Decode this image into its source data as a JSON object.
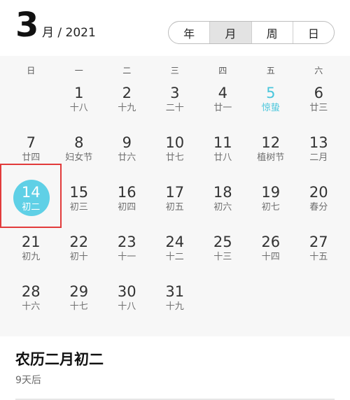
{
  "header": {
    "month_number": "3",
    "month_suffix": "月 / 2021",
    "view_tabs": [
      {
        "label": "年",
        "active": false
      },
      {
        "label": "月",
        "active": true
      },
      {
        "label": "周",
        "active": false
      },
      {
        "label": "日",
        "active": false
      }
    ]
  },
  "weekdays": [
    "日",
    "一",
    "二",
    "三",
    "四",
    "五",
    "六"
  ],
  "calendar": {
    "weeks": [
      [
        {
          "day": "",
          "lunar": ""
        },
        {
          "day": "1",
          "lunar": "十八"
        },
        {
          "day": "2",
          "lunar": "十九"
        },
        {
          "day": "3",
          "lunar": "二十"
        },
        {
          "day": "4",
          "lunar": "廿一"
        },
        {
          "day": "5",
          "lunar": "惊蛰",
          "holiday": true
        },
        {
          "day": "6",
          "lunar": "廿三"
        }
      ],
      [
        {
          "day": "7",
          "lunar": "廿四"
        },
        {
          "day": "8",
          "lunar": "妇女节"
        },
        {
          "day": "9",
          "lunar": "廿六"
        },
        {
          "day": "10",
          "lunar": "廿七"
        },
        {
          "day": "11",
          "lunar": "廿八"
        },
        {
          "day": "12",
          "lunar": "植树节"
        },
        {
          "day": "13",
          "lunar": "二月"
        }
      ],
      [
        {
          "day": "14",
          "lunar": "初二",
          "selected": true
        },
        {
          "day": "15",
          "lunar": "初三"
        },
        {
          "day": "16",
          "lunar": "初四"
        },
        {
          "day": "17",
          "lunar": "初五"
        },
        {
          "day": "18",
          "lunar": "初六"
        },
        {
          "day": "19",
          "lunar": "初七"
        },
        {
          "day": "20",
          "lunar": "春分"
        }
      ],
      [
        {
          "day": "21",
          "lunar": "初九"
        },
        {
          "day": "22",
          "lunar": "初十"
        },
        {
          "day": "23",
          "lunar": "十一"
        },
        {
          "day": "24",
          "lunar": "十二"
        },
        {
          "day": "25",
          "lunar": "十三"
        },
        {
          "day": "26",
          "lunar": "十四"
        },
        {
          "day": "27",
          "lunar": "十五"
        }
      ],
      [
        {
          "day": "28",
          "lunar": "十六"
        },
        {
          "day": "29",
          "lunar": "十七"
        },
        {
          "day": "30",
          "lunar": "十八"
        },
        {
          "day": "31",
          "lunar": "十九"
        },
        {
          "day": "",
          "lunar": ""
        },
        {
          "day": "",
          "lunar": ""
        },
        {
          "day": "",
          "lunar": ""
        }
      ]
    ]
  },
  "info": {
    "title": "农历二月初二",
    "subtitle": "9天后"
  },
  "colors": {
    "accent": "#5fd0e6",
    "holiday_text": "#49c6dc",
    "highlight_box": "#e23b3b"
  }
}
